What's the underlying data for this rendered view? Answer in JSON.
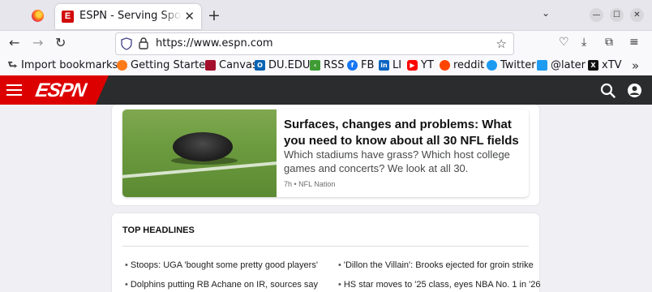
{
  "browser": {
    "tab_title": "ESPN - Serving Sports Fans",
    "tab_favicon_letter": "E",
    "url": "https://www.espn.com",
    "accent": "#d00000"
  },
  "bookmarks": [
    {
      "label": "Import bookmarks...",
      "icon": "import-icon",
      "color": "#555555"
    },
    {
      "label": "Getting Started",
      "icon": "firefox-icon",
      "color": "#ff7a18"
    },
    {
      "label": "Canvas",
      "icon": "canvas-icon",
      "color": "#a4102c"
    },
    {
      "label": "DU.EDU",
      "icon": "outlook-icon",
      "color": "#0a64b4"
    },
    {
      "label": "RSS",
      "icon": "rss-icon",
      "color": "#3f9c35"
    },
    {
      "label": "FB",
      "icon": "facebook-icon",
      "color": "#1877f2"
    },
    {
      "label": "LI",
      "icon": "linkedin-icon",
      "color": "#0a66c2"
    },
    {
      "label": "YT",
      "icon": "youtube-icon",
      "color": "#ff0000"
    },
    {
      "label": "reddit",
      "icon": "reddit-icon",
      "color": "#ff4500"
    },
    {
      "label": "Twitter",
      "icon": "twitter-icon",
      "color": "#1d9bf0"
    },
    {
      "label": "@later",
      "icon": "twitter-icon",
      "color": "#1d9bf0"
    },
    {
      "label": "xTV",
      "icon": "x-icon",
      "color": "#111111"
    }
  ],
  "espn": {
    "logo_text": "ESPN",
    "brand_red": "#dd0000",
    "header_bg": "#2b2c2d"
  },
  "featured_story": {
    "headline": "Surfaces, changes and problems: What you need to know about all 30 NFL fields",
    "description": "Which stadiums have grass? Which host college games and concerts? We look at all 30.",
    "meta": "7h • NFL Nation"
  },
  "top_headlines": {
    "title": "TOP HEADLINES",
    "items": [
      "Stoops: UGA 'bought some pretty good players'",
      "'Dillon the Villain': Brooks ejected for groin strike",
      "Dolphins putting RB Achane on IR, sources say",
      "HS star moves to '25 class, eyes NBA No. 1 in '26"
    ]
  }
}
